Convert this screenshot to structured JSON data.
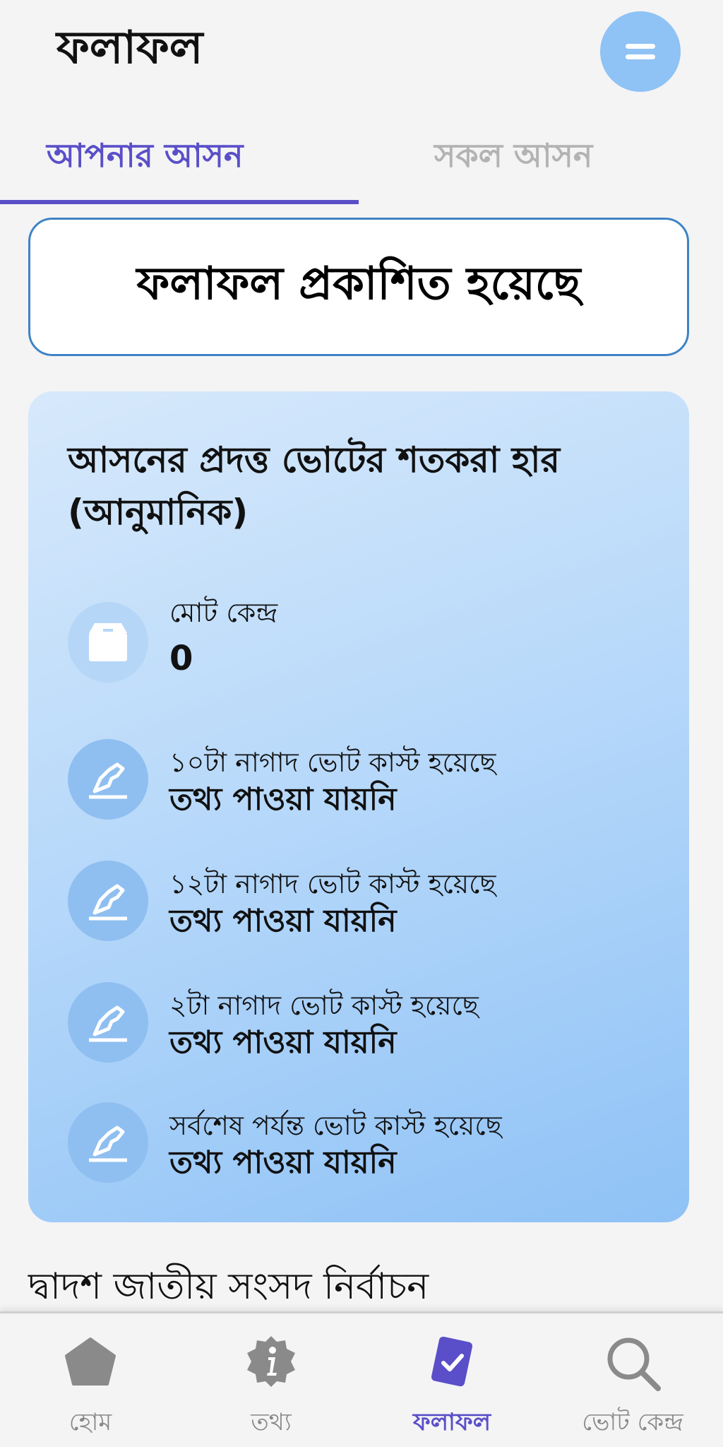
{
  "header": {
    "title": "ফলাফল",
    "menu_icon": "menu-icon"
  },
  "tabs": [
    {
      "label": "আপনার আসন",
      "active": true
    },
    {
      "label": "সকল আসন",
      "active": false
    }
  ],
  "status": {
    "text": "ফলাফল প্রকাশিত হয়েছে"
  },
  "turnout_card": {
    "title": " আসনের প্রদত্ত ভোটের শতকরা হার (আনুমানিক)",
    "total_centers": {
      "label": "মোট কেন্দ্র",
      "value": "0",
      "icon": "ballot-box-icon"
    },
    "rows": [
      {
        "label": "১০টা  নাগাদ ভোট কাস্ট হয়েছে",
        "value": "তথ্য পাওয়া যায়নি",
        "icon": "vote-cast-icon"
      },
      {
        "label": "১২টা  নাগাদ ভোট কাস্ট হয়েছে",
        "value": "তথ্য পাওয়া যায়নি",
        "icon": "vote-cast-icon"
      },
      {
        "label": "২টা  নাগাদ ভোট কাস্ট হয়েছে",
        "value": "তথ্য পাওয়া যায়নি",
        "icon": "vote-cast-icon"
      },
      {
        "label": "সর্বশেষ পর্যন্ত ভোট কাস্ট হয়েছে",
        "value": "তথ্য পাওয়া যায়নি",
        "icon": "vote-cast-icon"
      }
    ]
  },
  "election_title": "দ্বাদশ জাতীয় সংসদ নির্বাচন",
  "bottom_nav": [
    {
      "label": "হোম",
      "icon": "home-icon",
      "active": false
    },
    {
      "label": "তথ্য",
      "icon": "info-icon",
      "active": false
    },
    {
      "label": "ফলাফল",
      "icon": "results-icon",
      "active": true
    },
    {
      "label": "ভোট কেন্দ্র",
      "icon": "search-icon",
      "active": false
    }
  ],
  "colors": {
    "accent": "#5a4fc8",
    "inactive_tab": "#b3b3b3",
    "menu_button": "#8fc2f5",
    "status_border": "#3f84c4",
    "icon_circle": "#8fbff0"
  }
}
